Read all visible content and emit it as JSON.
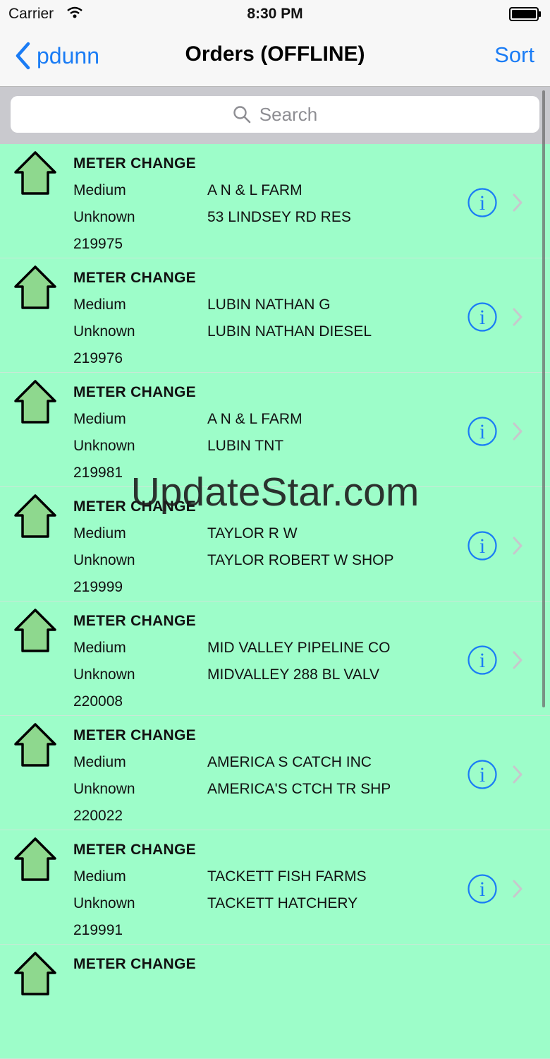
{
  "status_bar": {
    "carrier": "Carrier",
    "time": "8:30 PM"
  },
  "nav": {
    "back_label": "pdunn",
    "title": "Orders (OFFLINE)",
    "sort_label": "Sort"
  },
  "search": {
    "placeholder": "Search"
  },
  "orders": [
    {
      "type": "METER CHANGE",
      "priority": "Medium",
      "status": "Unknown",
      "id": "219975",
      "customer": "A N & L FARM",
      "location": "53 LINDSEY RD RES"
    },
    {
      "type": "METER CHANGE",
      "priority": "Medium",
      "status": "Unknown",
      "id": "219976",
      "customer": "LUBIN NATHAN G",
      "location": "LUBIN NATHAN DIESEL"
    },
    {
      "type": "METER CHANGE",
      "priority": "Medium",
      "status": "Unknown",
      "id": "219981",
      "customer": "A N & L FARM",
      "location": "LUBIN TNT"
    },
    {
      "type": "METER CHANGE",
      "priority": "Medium",
      "status": "Unknown",
      "id": "219999",
      "customer": "TAYLOR R W",
      "location": "TAYLOR ROBERT W SHOP"
    },
    {
      "type": "METER CHANGE",
      "priority": "Medium",
      "status": "Unknown",
      "id": "220008",
      "customer": "MID VALLEY PIPELINE CO",
      "location": "MIDVALLEY 288 BL VALV"
    },
    {
      "type": "METER CHANGE",
      "priority": "Medium",
      "status": "Unknown",
      "id": "220022",
      "customer": "AMERICA S CATCH INC",
      "location": "AMERICA'S CTCH TR SHP"
    },
    {
      "type": "METER CHANGE",
      "priority": "Medium",
      "status": "Unknown",
      "id": "219991",
      "customer": "TACKETT FISH FARMS",
      "location": "TACKETT HATCHERY"
    },
    {
      "type": "METER CHANGE",
      "priority": "",
      "status": "",
      "id": "",
      "customer": "",
      "location": ""
    }
  ],
  "watermark": "UpdateStar.com",
  "colors": {
    "row_background": "#9dfdc9",
    "accent": "#1a7cf5",
    "house_fill": "#8ed88e"
  },
  "icons": {
    "house": "house-icon",
    "info": "info-icon",
    "chevron": "chevron-right-icon",
    "search": "search-icon",
    "back": "chevron-left-icon",
    "wifi": "wifi-icon",
    "battery": "battery-icon"
  }
}
